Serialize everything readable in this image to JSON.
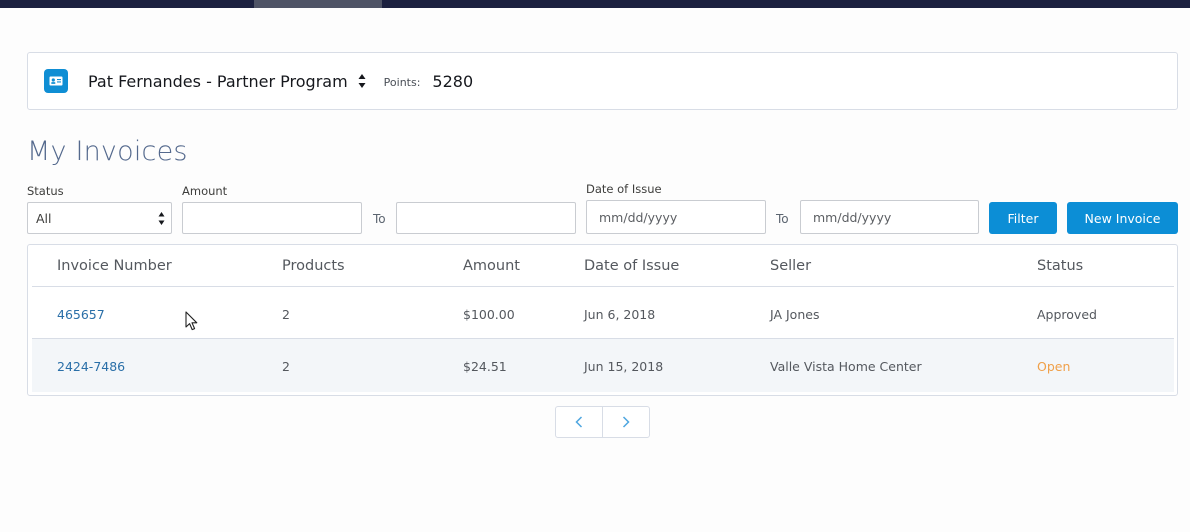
{
  "colors": {
    "accent": "#0c8ed6",
    "status_approved": "#54585e",
    "status_open": "#f0a049",
    "link": "#2a6fa8",
    "title": "#54698d"
  },
  "account": {
    "icon": "contact-card-icon",
    "name": "Pat Fernandes - Partner Program",
    "switch_icon": "sort-arrows-icon",
    "points_label": "Points:",
    "points_value": "5280"
  },
  "page": {
    "title": "My Invoices"
  },
  "filters": {
    "status_label": "Status",
    "status_value": "All",
    "amount_label": "Amount",
    "amount_from": "",
    "to_label_1": "To",
    "amount_to": "",
    "date_label": "Date of Issue",
    "date_from_placeholder": "mm/dd/yyyy",
    "to_label_2": "To",
    "date_to_placeholder": "mm/dd/yyyy",
    "filter_button": "Filter",
    "new_invoice_button": "New Invoice"
  },
  "table": {
    "headers": [
      "Invoice Number",
      "Products",
      "Amount",
      "Date of Issue",
      "Seller",
      "Status"
    ],
    "rows": [
      {
        "invoice": "465657",
        "products": "2",
        "amount": "$100.00",
        "date": "Jun 6, 2018",
        "seller": "JA Jones",
        "status": "Approved"
      },
      {
        "invoice": "2424-7486",
        "products": "2",
        "amount": "$24.51",
        "date": "Jun 15, 2018",
        "seller": "Valle Vista Home Center",
        "status": "Open"
      }
    ]
  },
  "pagination": {
    "prev_icon": "chevron-left-icon",
    "next_icon": "chevron-right-icon"
  }
}
